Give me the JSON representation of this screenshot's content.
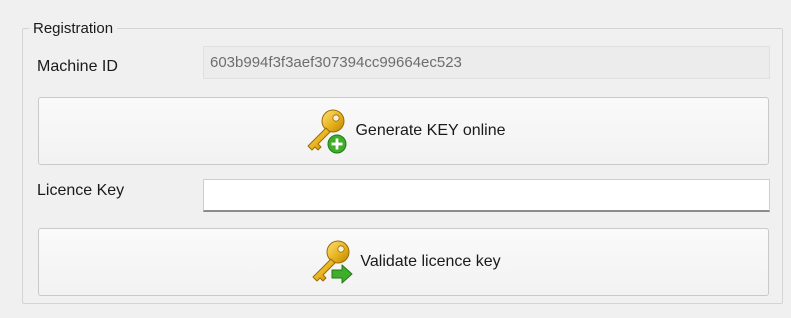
{
  "group": {
    "title": "Registration"
  },
  "machine_id": {
    "label": "Machine ID",
    "value": "603b994f3f3aef307394cc99664ec523"
  },
  "generate_button": {
    "label": "Generate KEY online",
    "icon": "key-add-icon"
  },
  "licence_key": {
    "label": "Licence Key",
    "value": "",
    "placeholder": ""
  },
  "validate_button": {
    "label": "Validate licence key",
    "icon": "key-forward-icon"
  },
  "colors": {
    "key_gold": "#e8b21c",
    "add_badge_green": "#3fae2a",
    "arrow_green": "#3fae2a",
    "readonly_field_bg": "#ececec"
  }
}
